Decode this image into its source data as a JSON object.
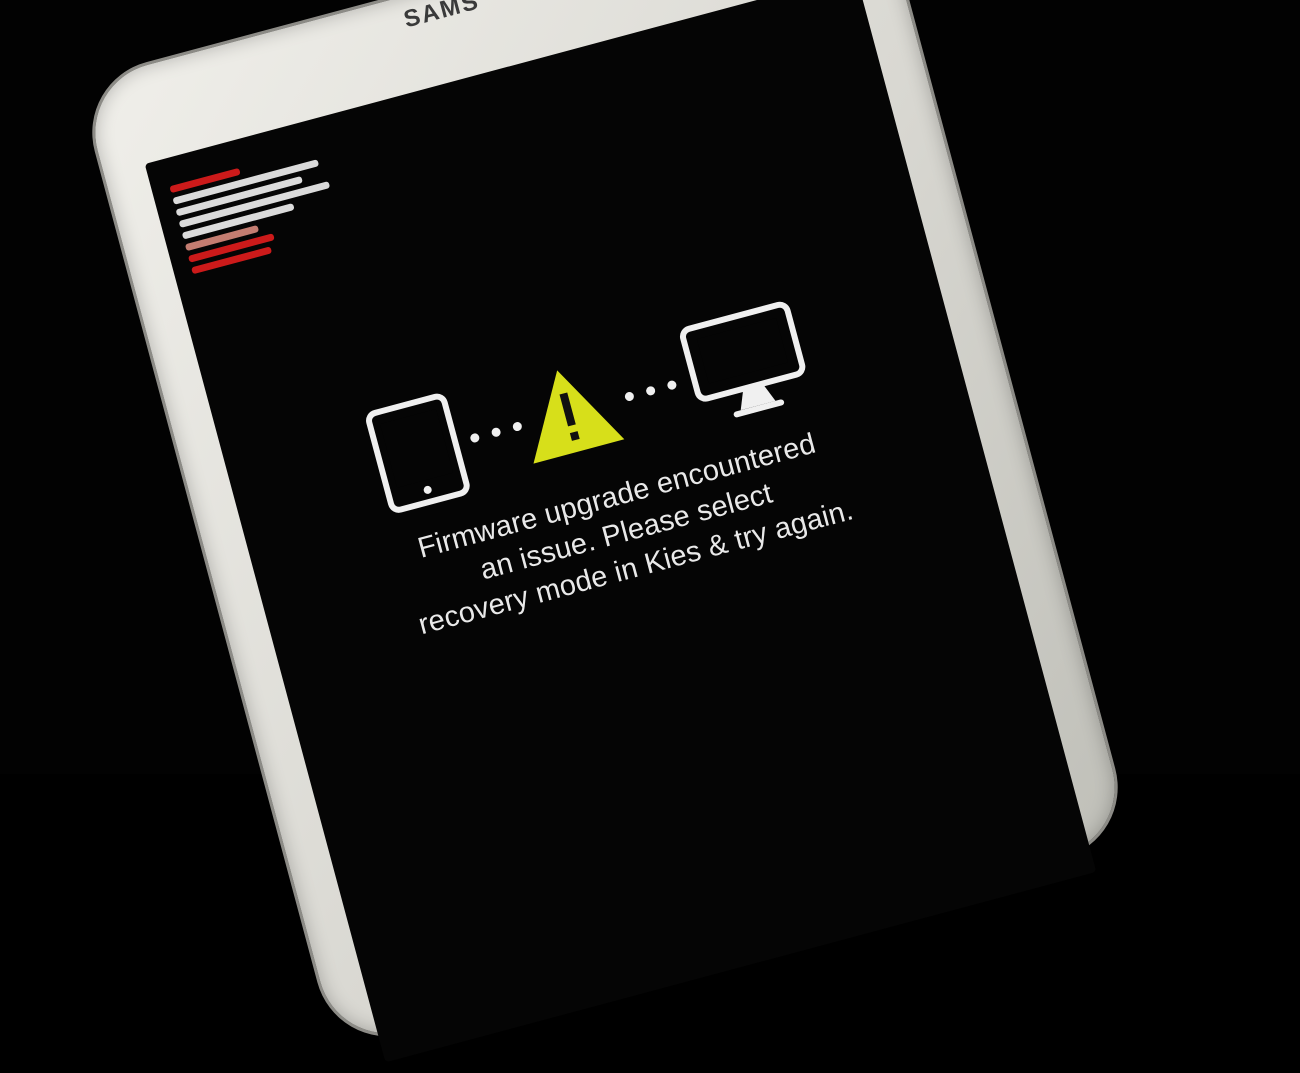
{
  "device": {
    "brand": "SAMS",
    "log_colors": {
      "white": "#f3f3f3",
      "red": "#e11d1d"
    }
  },
  "error_screen": {
    "message_lines": [
      "Firmware upgrade encountered",
      "an issue. Please select",
      "recovery mode in Kies & try again."
    ],
    "warning_color": "#d7df1a",
    "icons": [
      "phone-icon",
      "warning-icon",
      "computer-icon"
    ]
  }
}
